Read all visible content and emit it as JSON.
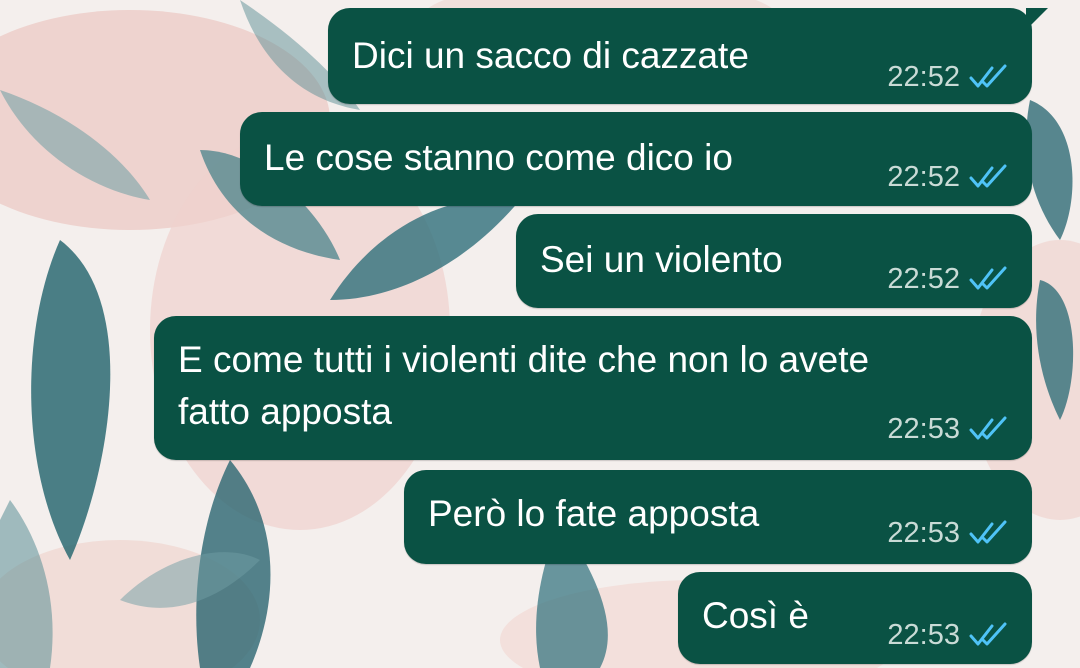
{
  "colors": {
    "bubble": "#0a5244",
    "text": "#ffffff",
    "time": "#c9dbd6",
    "read_ticks": "#4fc3f7"
  },
  "chat": {
    "messages": [
      {
        "text": "Dici un sacco di cazzate",
        "time": "22:52",
        "status_icon": "double-check-read-icon"
      },
      {
        "text": "Le cose stanno come dico io",
        "time": "22:52",
        "status_icon": "double-check-read-icon"
      },
      {
        "text": "Sei un violento",
        "time": "22:52",
        "status_icon": "double-check-read-icon"
      },
      {
        "text": "E come tutti i violenti dite che non lo avete\nfatto apposta",
        "time": "22:53",
        "status_icon": "double-check-read-icon"
      },
      {
        "text": "Però lo fate apposta",
        "time": "22:53",
        "status_icon": "double-check-read-icon"
      },
      {
        "text": "Così è",
        "time": "22:53",
        "status_icon": "double-check-read-icon"
      }
    ]
  }
}
